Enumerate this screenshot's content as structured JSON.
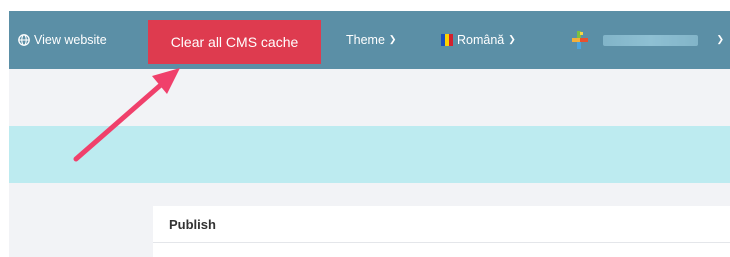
{
  "topbar": {
    "view_website_label": "View website",
    "clear_cache_label": "Clear all CMS cache",
    "theme_label": "Theme",
    "language_label": "Română",
    "user_name": ""
  },
  "panel": {
    "title": "Publish"
  },
  "colors": {
    "topbar_bg": "#5b8fa6",
    "cache_button_bg": "#de3b4f",
    "notice_bg": "#bdebf0",
    "content_bg": "#f2f3f6",
    "annotation_arrow": "#f0406b"
  },
  "icons": {
    "view_website": "globe-icon",
    "dropdown": "chevron-down-icon",
    "language": "romania-flag-icon",
    "user": "user-avatar-icon"
  }
}
